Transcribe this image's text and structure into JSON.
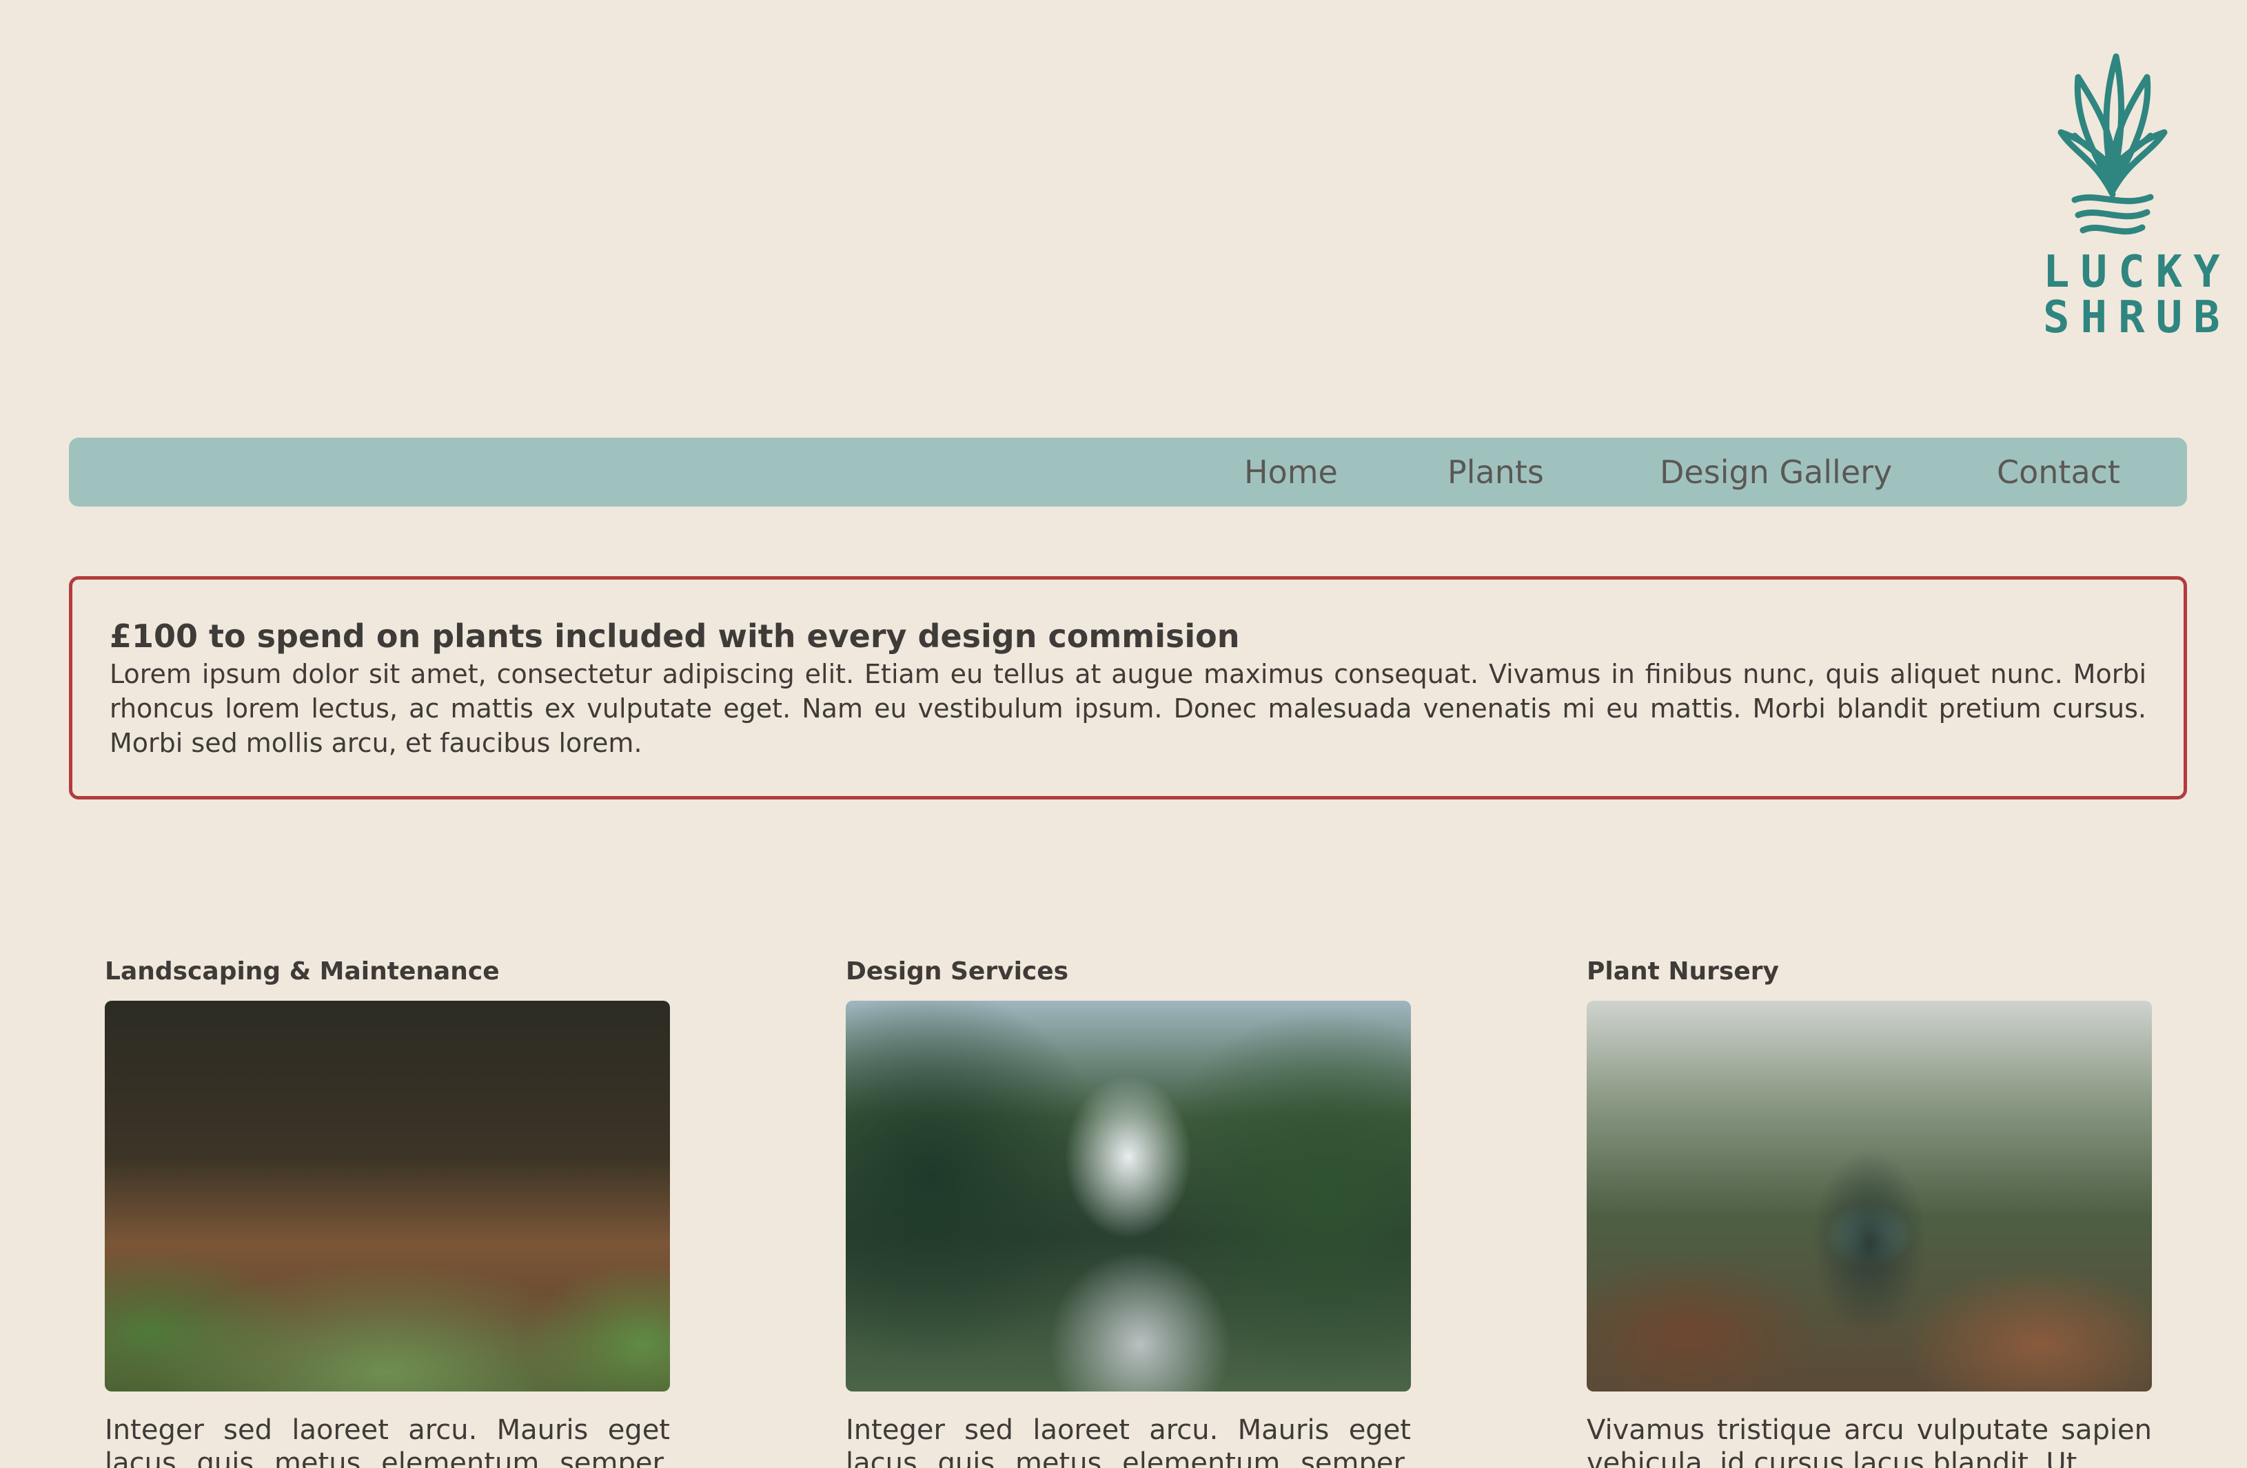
{
  "brand": {
    "logo_line1": "LUCKY",
    "logo_line2": "SHRUB",
    "accent_color": "#2f8580"
  },
  "nav": {
    "items": [
      {
        "label": "Home"
      },
      {
        "label": "Plants"
      },
      {
        "label": "Design Gallery"
      },
      {
        "label": "Contact"
      }
    ],
    "background": "#a0c2bf"
  },
  "promo": {
    "title": "£100 to spend on plants included with every design commision",
    "body": "Lorem ipsum dolor sit amet, consectetur adipiscing elit. Etiam eu tellus at augue maximus consequat. Vivamus in finibus nunc, quis aliquet nunc. Morbi rhoncus lorem lectus, ac mattis ex vulputate eget. Nam eu vestibulum ipsum. Donec malesuada venenatis mi eu mattis. Morbi blandit pretium cursus. Morbi sed mollis arcu, et faucibus lorem.",
    "border_color": "#b13c3e"
  },
  "services": [
    {
      "title": "Landscaping & Maintenance",
      "image_alt": "Water droplets sprinkling over plants",
      "text": "Integer sed laoreet arcu. Mauris eget lacus quis metus elementum semper. Phasellus"
    },
    {
      "title": "Design Services",
      "image_alt": "Greenhouse path lined with lush plants",
      "text": "Integer sed laoreet arcu. Mauris eget lacus quis metus elementum semper. Phasellus"
    },
    {
      "title": "Plant Nursery",
      "image_alt": "Person with backpack browsing a plant nursery",
      "text": "Vivamus tristique arcu vulputate sapien vehicula, id cursus lacus blandit. Ut"
    }
  ]
}
